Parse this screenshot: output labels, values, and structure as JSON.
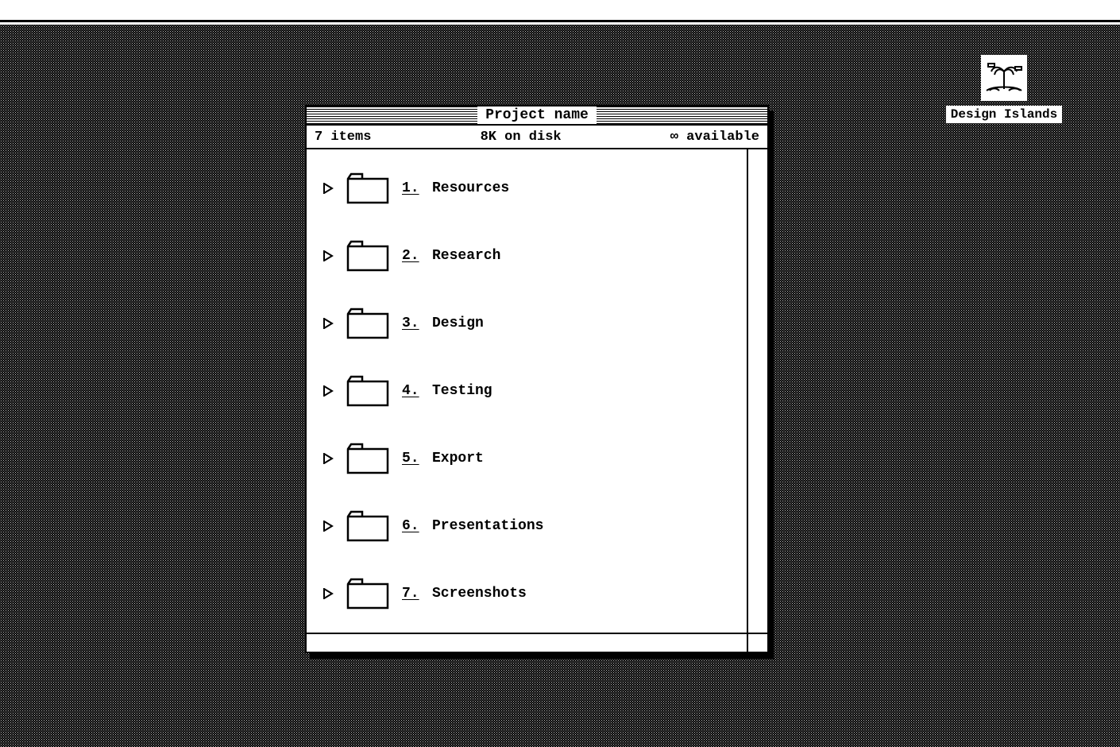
{
  "desktop": {
    "disk_label": "Design Islands"
  },
  "window": {
    "title": "Project name",
    "info": {
      "items": "7 items",
      "disk": "8K on disk",
      "available": "∞ available"
    },
    "folders": [
      {
        "num": "1.",
        "name": "Resources"
      },
      {
        "num": "2.",
        "name": "Research"
      },
      {
        "num": "3.",
        "name": "Design"
      },
      {
        "num": "4.",
        "name": "Testing"
      },
      {
        "num": "5.",
        "name": "Export"
      },
      {
        "num": "6.",
        "name": "Presentations"
      },
      {
        "num": "7.",
        "name": "Screenshots"
      }
    ]
  }
}
